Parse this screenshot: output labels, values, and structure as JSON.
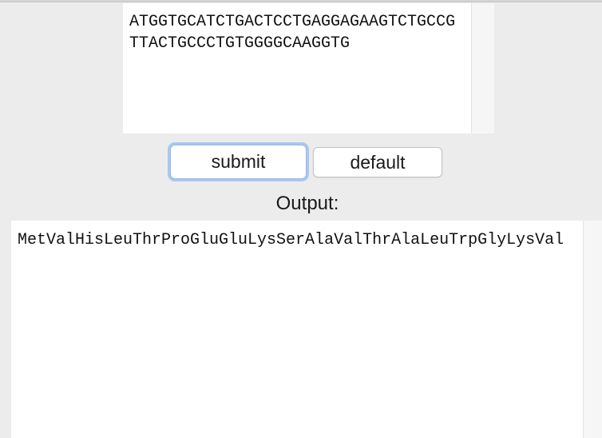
{
  "input": {
    "sequence": "ATGGTGCATCTGACTCCTGAGGAGAAGTCTGCCGTTACTGCCCTGTGGGGCAAGGTG"
  },
  "buttons": {
    "submit_label": "submit",
    "default_label": "default"
  },
  "output": {
    "label": "Output:",
    "value": "MetValHisLeuThrProGluGluLysSerAlaValThrAlaLeuTrpGlyLysVal"
  },
  "colors": {
    "window_background": "#ececec",
    "field_background": "#ffffff",
    "focus_ring": "#a9c7f2"
  }
}
